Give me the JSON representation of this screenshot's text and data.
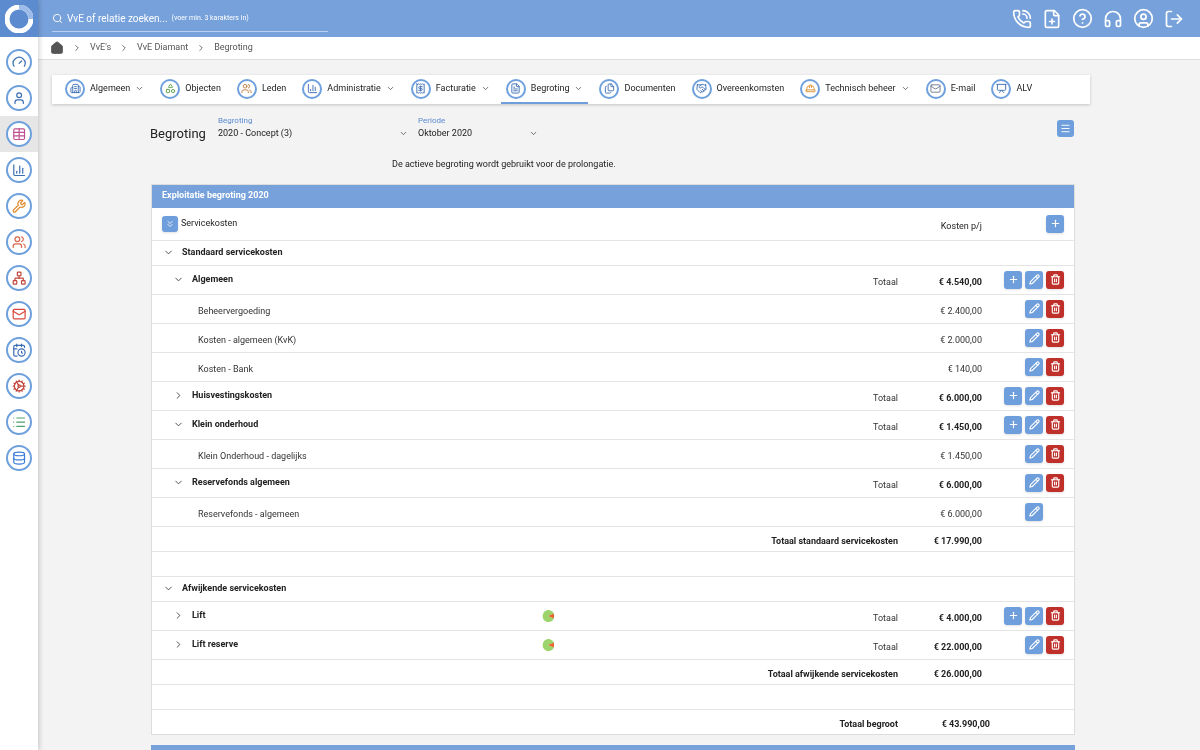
{
  "search": {
    "placeholder": "VvE of relatie zoeken...",
    "hint": "(voer min. 3 karakters in)"
  },
  "sidebar": {
    "items": [
      {
        "kind": "gauge",
        "selected": false
      },
      {
        "kind": "person",
        "selected": false
      },
      {
        "kind": "table",
        "selected": true
      },
      {
        "kind": "chart",
        "selected": false
      },
      {
        "kind": "tools",
        "selected": false
      },
      {
        "kind": "people",
        "selected": false
      },
      {
        "kind": "hierarchy",
        "selected": false
      },
      {
        "kind": "mail",
        "selected": false
      },
      {
        "kind": "calendar",
        "selected": false
      },
      {
        "kind": "gears",
        "selected": false
      },
      {
        "kind": "list",
        "selected": false
      },
      {
        "kind": "database",
        "selected": false
      }
    ]
  },
  "breadcrumb": [
    "VvE's",
    "VvE Diamant",
    "Begroting"
  ],
  "tabs": [
    {
      "label": "Algemeen",
      "kind": "building",
      "has_menu": true,
      "selected": false
    },
    {
      "label": "Objecten",
      "kind": "objects",
      "has_menu": false,
      "selected": false
    },
    {
      "label": "Leden",
      "kind": "people",
      "has_menu": false,
      "selected": false
    },
    {
      "label": "Administratie",
      "kind": "chart",
      "has_menu": true,
      "selected": false
    },
    {
      "label": "Facturatie",
      "kind": "invoice",
      "has_menu": true,
      "selected": false
    },
    {
      "label": "Begroting",
      "kind": "budget",
      "has_menu": true,
      "selected": true
    },
    {
      "label": "Documenten",
      "kind": "documents",
      "has_menu": false,
      "selected": false
    },
    {
      "label": "Overeenkomsten",
      "kind": "handshake",
      "has_menu": false,
      "selected": false
    },
    {
      "label": "Technisch beheer",
      "kind": "worker",
      "has_menu": true,
      "selected": false
    },
    {
      "label": "E-mail",
      "kind": "mail",
      "has_menu": false,
      "selected": false
    },
    {
      "label": "ALV",
      "kind": "meeting",
      "has_menu": false,
      "selected": false
    }
  ],
  "page_title": "Begroting",
  "selects": [
    {
      "label": "Begroting",
      "value": "2020 - Concept (3)"
    },
    {
      "label": "Periode",
      "value": "Oktober 2020"
    }
  ],
  "info": "De actieve begroting wordt gebruikt voor de prolongatie.",
  "table": {
    "title": "Exploitatie begroting 2020",
    "header": {
      "label": "Servicekosten",
      "amount_label": "Kosten p/j"
    },
    "sections": [
      {
        "label": "Standaard servicekosten",
        "expanded": true,
        "children": [
          {
            "label": "Algemeen",
            "expanded": true,
            "total_label": "Totaal",
            "amount": "€ 4.540,00",
            "can_add": true,
            "can_edit": true,
            "can_delete": true,
            "children": [
              {
                "label": "Beheervergoeding",
                "amount": "€ 2.400,00",
                "can_add": false,
                "can_edit": true,
                "can_delete": true
              },
              {
                "label": "Kosten - algemeen (KvK)",
                "amount": "€ 2.000,00",
                "can_add": false,
                "can_edit": true,
                "can_delete": true
              },
              {
                "label": "Kosten - Bank",
                "amount": "€ 140,00",
                "can_add": false,
                "can_edit": true,
                "can_delete": true
              }
            ]
          },
          {
            "label": "Huisvestingskosten",
            "expanded": false,
            "total_label": "Totaal",
            "amount": "€ 6.000,00",
            "can_add": true,
            "can_edit": true,
            "can_delete": true
          },
          {
            "label": "Klein onderhoud",
            "expanded": true,
            "total_label": "Totaal",
            "amount": "€ 1.450,00",
            "can_add": true,
            "can_edit": true,
            "can_delete": true,
            "children": [
              {
                "label": "Klein Onderhoud - dagelijks",
                "amount": "€ 1.450,00",
                "can_add": false,
                "can_edit": true,
                "can_delete": true
              }
            ]
          },
          {
            "label": "Reservefonds algemeen",
            "expanded": true,
            "total_label": "Totaal",
            "amount": "€ 6.000,00",
            "can_add": false,
            "can_edit": true,
            "can_delete": true,
            "children": [
              {
                "label": "Reservefonds - algemeen",
                "amount": "€ 6.000,00",
                "can_add": false,
                "can_edit": true,
                "can_delete": false
              }
            ]
          }
        ],
        "subtotal": {
          "label": "Totaal standaard servicekosten",
          "amount": "€ 17.990,00"
        }
      },
      {
        "label": "Afwijkende servicekosten",
        "expanded": true,
        "children": [
          {
            "label": "Lift",
            "expanded": false,
            "allocation_icon": true,
            "total_label": "Totaal",
            "amount": "€ 4.000,00",
            "can_add": true,
            "can_edit": true,
            "can_delete": true
          },
          {
            "label": "Lift reserve",
            "expanded": false,
            "allocation_icon": true,
            "total_label": "Totaal",
            "amount": "€ 22.000,00",
            "can_add": false,
            "can_edit": true,
            "can_delete": true
          }
        ],
        "subtotal": {
          "label": "Totaal afwijkende servicekosten",
          "amount": "€ 26.000,00"
        }
      }
    ],
    "grand_total": {
      "label": "Totaal begroot",
      "amount": "€ 43.990,00"
    }
  }
}
